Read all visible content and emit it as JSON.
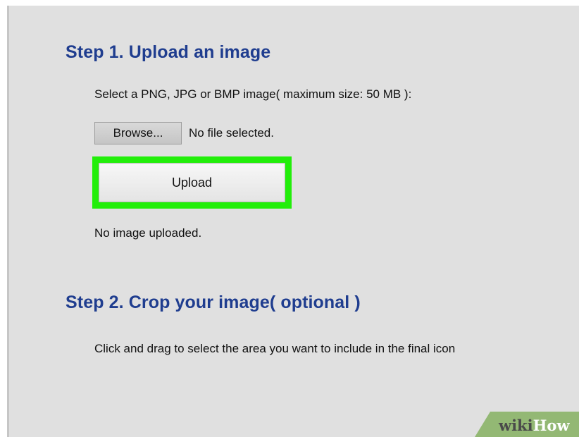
{
  "step1": {
    "heading": "Step 1. Upload an image",
    "instruction": "Select a PNG, JPG or BMP image( maximum size: 50 MB ):",
    "browse_label": "Browse...",
    "file_status": "No file selected.",
    "upload_label": "Upload",
    "upload_status": "No image uploaded."
  },
  "step2": {
    "heading": "Step 2. Crop your image( optional )",
    "instruction": "Click and drag to select the area you want to include in the final icon"
  },
  "watermark": {
    "part1": "wiki",
    "part2": "How"
  },
  "colors": {
    "heading": "#1f3d8f",
    "highlight": "#22ee0a",
    "background": "#e0e0e0",
    "watermark_green": "#93b874"
  }
}
